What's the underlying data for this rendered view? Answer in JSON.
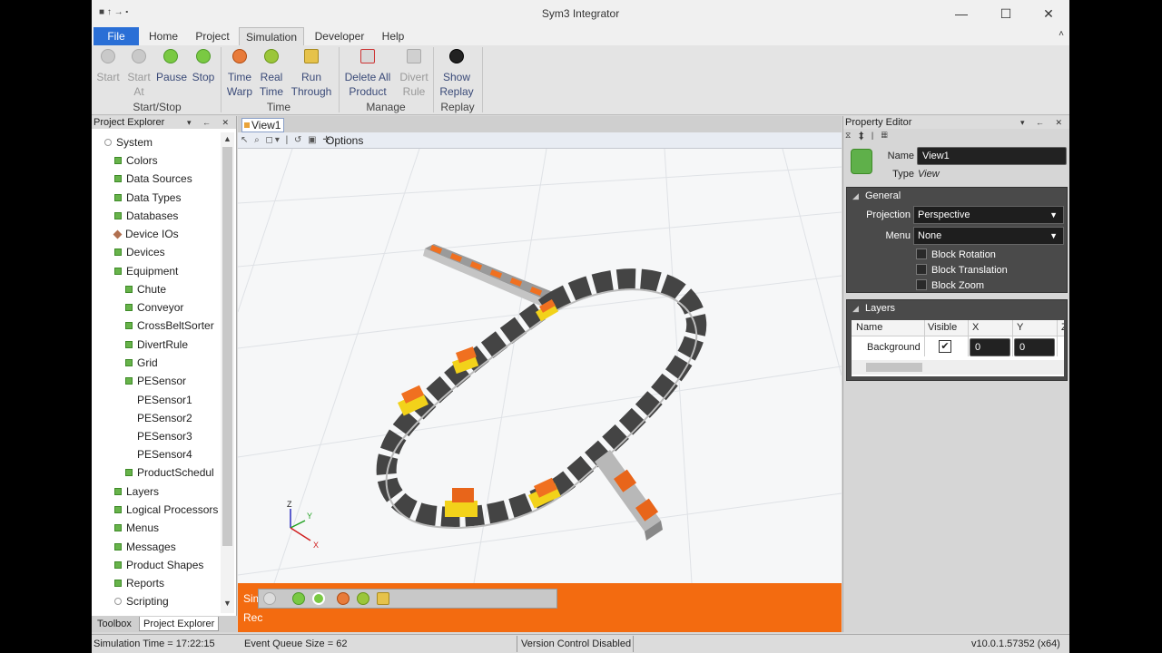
{
  "window": {
    "title": "Sym3 Integrator",
    "qa_toolbar": "■ ↑ → ⬝",
    "minimize": "—",
    "maximize": "☐",
    "close": "✕"
  },
  "ribbon": {
    "tabs": [
      "File",
      "Home",
      "Project",
      "Simulation",
      "Developer",
      "Help"
    ],
    "active_tab": "Simulation",
    "collapse": "˄",
    "buttons": {
      "start": "Start",
      "start_at_1": "Start",
      "start_at_2": "At",
      "pause": "Pause",
      "stop": "Stop",
      "time_warp_1": "Time",
      "time_warp_2": "Warp",
      "real_time_1": "Real",
      "real_time_2": "Time",
      "run_through_1": "Run",
      "run_through_2": "Through",
      "delete_all_1": "Delete All",
      "delete_all_2": "Product",
      "divert_1": "Divert",
      "divert_2": "Rule",
      "show_replay_1": "Show",
      "show_replay_2": "Replay"
    },
    "groups": [
      "Start/Stop",
      "Time",
      "Manage",
      "Replay"
    ]
  },
  "explorer": {
    "title": "Project Explorer",
    "root": "System",
    "items": [
      "Colors",
      "Data Sources",
      "Data Types",
      "Databases",
      "Device IOs",
      "Devices",
      "Equipment",
      "Chute",
      "Conveyor",
      "CrossBeltSorter",
      "DivertRule",
      "Grid",
      "PESensor",
      "PESensor1",
      "PESensor2",
      "PESensor3",
      "PESensor4",
      "ProductSchedul",
      "Layers",
      "Logical Processors",
      "Menus",
      "Messages",
      "Product Shapes",
      "Reports",
      "Scripting"
    ],
    "bottom_tabs": [
      "Toolbox",
      "Project Explorer"
    ],
    "panel_buttons": "▾ ← ✕"
  },
  "view": {
    "tab": "View1",
    "options": "Options",
    "toolbar_icons": "↖ ⌕ ◻▾ | ↺ ▣ ✛",
    "axis_labels": {
      "z": "Z",
      "y": "Y",
      "x": "X"
    },
    "sim_label_1": "Sim",
    "sim_label_2": "Rec"
  },
  "property_editor": {
    "title": "Property Editor",
    "tools": "⧖ ⬍ | ▦",
    "name_label": "Name",
    "name_value": "View1",
    "type_label": "Type",
    "type_value": "View",
    "general": {
      "title": "General",
      "projection_label": "Projection",
      "projection_value": "Perspective",
      "menu_label": "Menu",
      "menu_value": "None",
      "checkboxes": [
        "Block Rotation",
        "Block Translation",
        "Block Zoom"
      ]
    },
    "layers": {
      "title": "Layers",
      "columns": [
        "Name",
        "Visible",
        "X",
        "Y",
        "Z"
      ],
      "row": {
        "name": "Background",
        "visible": "✔",
        "x": "0",
        "y": "0"
      }
    }
  },
  "status": {
    "sim_time": "Simulation Time = 17:22:15",
    "queue": "Event Queue Size = 62",
    "version_control": "Version Control Disabled",
    "version": "v10.0.1.57352 (x64)"
  },
  "colors": {
    "accent_blue": "#2a6fd6",
    "orange": "#f36b10",
    "folder_green": "#67b34a",
    "panel_dark": "#4a4a4a"
  }
}
